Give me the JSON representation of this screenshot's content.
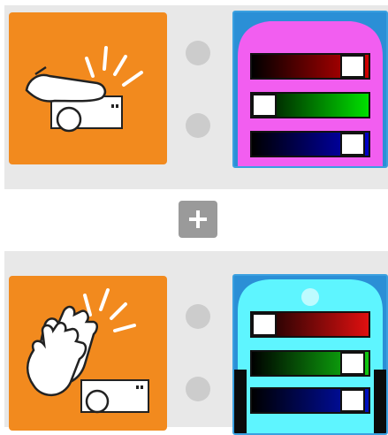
{
  "rules": [
    {
      "trigger_icon": "hand-press-icon",
      "action_icon": "rgb-led-sliders-icon",
      "led_color": "#f25ef0",
      "sliders": [
        {
          "channel": "red",
          "level": 1.0
        },
        {
          "channel": "green",
          "level": 0.0
        },
        {
          "channel": "blue",
          "level": 1.0
        }
      ]
    },
    {
      "trigger_icon": "hands-clap-icon",
      "action_icon": "rgb-led-sliders-icon",
      "led_color": "#5ef5ff",
      "sliders": [
        {
          "channel": "red",
          "level": 0.0
        },
        {
          "channel": "green",
          "level": 1.0
        },
        {
          "channel": "blue",
          "level": 1.0
        }
      ]
    }
  ],
  "add_button": {
    "icon": "plus-icon"
  },
  "colors": {
    "trigger_bg": "#f28a1e",
    "action_bg": "#2b8fd6",
    "row_bg": "#e8e8e8",
    "port": "#cccccc",
    "add_button": "#9a9a9a"
  }
}
